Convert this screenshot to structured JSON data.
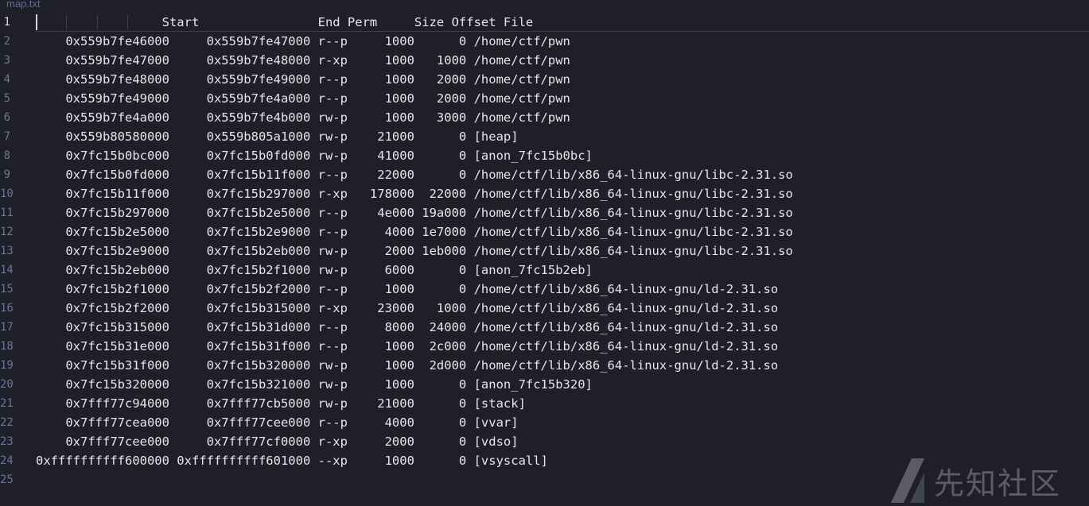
{
  "window": {
    "tab_title": "map.txt"
  },
  "editor": {
    "current_line": 1,
    "lines": [
      {
        "number": "1",
        "text": "                 Start                End Perm     Size Offset File"
      },
      {
        "number": "2",
        "text": "    0x559b7fe46000     0x559b7fe47000 r--p     1000      0 /home/ctf/pwn"
      },
      {
        "number": "3",
        "text": "    0x559b7fe47000     0x559b7fe48000 r-xp     1000   1000 /home/ctf/pwn"
      },
      {
        "number": "4",
        "text": "    0x559b7fe48000     0x559b7fe49000 r--p     1000   2000 /home/ctf/pwn"
      },
      {
        "number": "5",
        "text": "    0x559b7fe49000     0x559b7fe4a000 r--p     1000   2000 /home/ctf/pwn"
      },
      {
        "number": "6",
        "text": "    0x559b7fe4a000     0x559b7fe4b000 rw-p     1000   3000 /home/ctf/pwn"
      },
      {
        "number": "7",
        "text": "    0x559b80580000     0x559b805a1000 rw-p    21000      0 [heap]"
      },
      {
        "number": "8",
        "text": "    0x7fc15b0bc000     0x7fc15b0fd000 rw-p    41000      0 [anon_7fc15b0bc]"
      },
      {
        "number": "9",
        "text": "    0x7fc15b0fd000     0x7fc15b11f000 r--p    22000      0 /home/ctf/lib/x86_64-linux-gnu/libc-2.31.so"
      },
      {
        "number": "10",
        "text": "    0x7fc15b11f000     0x7fc15b297000 r-xp   178000  22000 /home/ctf/lib/x86_64-linux-gnu/libc-2.31.so"
      },
      {
        "number": "11",
        "text": "    0x7fc15b297000     0x7fc15b2e5000 r--p    4e000 19a000 /home/ctf/lib/x86_64-linux-gnu/libc-2.31.so"
      },
      {
        "number": "12",
        "text": "    0x7fc15b2e5000     0x7fc15b2e9000 r--p     4000 1e7000 /home/ctf/lib/x86_64-linux-gnu/libc-2.31.so"
      },
      {
        "number": "13",
        "text": "    0x7fc15b2e9000     0x7fc15b2eb000 rw-p     2000 1eb000 /home/ctf/lib/x86_64-linux-gnu/libc-2.31.so"
      },
      {
        "number": "14",
        "text": "    0x7fc15b2eb000     0x7fc15b2f1000 rw-p     6000      0 [anon_7fc15b2eb]"
      },
      {
        "number": "15",
        "text": "    0x7fc15b2f1000     0x7fc15b2f2000 r--p     1000      0 /home/ctf/lib/x86_64-linux-gnu/ld-2.31.so"
      },
      {
        "number": "16",
        "text": "    0x7fc15b2f2000     0x7fc15b315000 r-xp    23000   1000 /home/ctf/lib/x86_64-linux-gnu/ld-2.31.so"
      },
      {
        "number": "17",
        "text": "    0x7fc15b315000     0x7fc15b31d000 r--p     8000  24000 /home/ctf/lib/x86_64-linux-gnu/ld-2.31.so"
      },
      {
        "number": "18",
        "text": "    0x7fc15b31e000     0x7fc15b31f000 r--p     1000  2c000 /home/ctf/lib/x86_64-linux-gnu/ld-2.31.so"
      },
      {
        "number": "19",
        "text": "    0x7fc15b31f000     0x7fc15b320000 rw-p     1000  2d000 /home/ctf/lib/x86_64-linux-gnu/ld-2.31.so"
      },
      {
        "number": "20",
        "text": "    0x7fc15b320000     0x7fc15b321000 rw-p     1000      0 [anon_7fc15b320]"
      },
      {
        "number": "21",
        "text": "    0x7fff77c94000     0x7fff77cb5000 rw-p    21000      0 [stack]"
      },
      {
        "number": "22",
        "text": "    0x7fff77cea000     0x7fff77cee000 r--p     4000      0 [vvar]"
      },
      {
        "number": "23",
        "text": "    0x7fff77cee000     0x7fff77cf0000 r-xp     2000      0 [vdso]"
      },
      {
        "number": "24",
        "text": "0xffffffffff600000 0xffffffffff601000 --xp     1000      0 [vsyscall]"
      },
      {
        "number": "25",
        "text": ""
      }
    ]
  },
  "watermark": {
    "text": "先知社区",
    "logo_icon": "slash-logo-icon"
  }
}
